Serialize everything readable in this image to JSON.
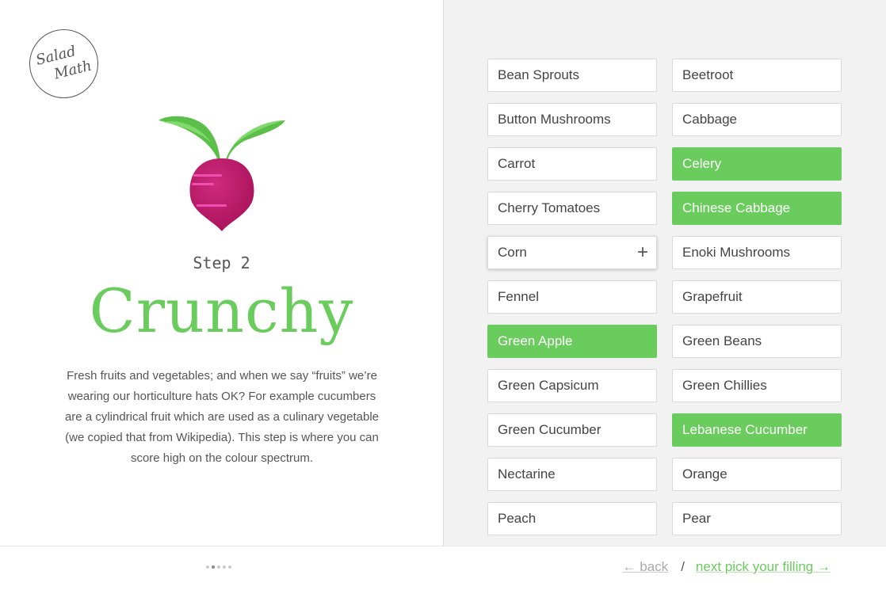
{
  "logo": {
    "line1": "Salad",
    "line2": "Math"
  },
  "step": {
    "label": "Step 2",
    "title": "Crunchy",
    "description": "Fresh fruits and vegetables; and when we say “fruits” we’re wearing our horticulture hats OK? For example cucumbers are a cylindrical fruit which are used as a culinary vegetable (we copied that from Wikipedia). This step is where you can score high on the colour spectrum."
  },
  "ingredients": [
    {
      "label": "Bean Sprouts",
      "selected": false
    },
    {
      "label": "Beetroot",
      "selected": false
    },
    {
      "label": "Button Mushrooms",
      "selected": false
    },
    {
      "label": "Cabbage",
      "selected": false
    },
    {
      "label": "Carrot",
      "selected": false
    },
    {
      "label": "Celery",
      "selected": true
    },
    {
      "label": "Cherry Tomatoes",
      "selected": false
    },
    {
      "label": "Chinese Cabbage",
      "selected": true
    },
    {
      "label": "Corn",
      "selected": false,
      "hover": true,
      "action_icon": "+"
    },
    {
      "label": "Enoki Mushrooms",
      "selected": false
    },
    {
      "label": "Fennel",
      "selected": false
    },
    {
      "label": "Grapefruit",
      "selected": false
    },
    {
      "label": "Green Apple",
      "selected": true
    },
    {
      "label": "Green Beans",
      "selected": false
    },
    {
      "label": "Green Capsicum",
      "selected": false
    },
    {
      "label": "Green Chillies",
      "selected": false
    },
    {
      "label": "Green Cucumber",
      "selected": false
    },
    {
      "label": "Lebanese Cucumber",
      "selected": true
    },
    {
      "label": "Nectarine",
      "selected": false
    },
    {
      "label": "Orange",
      "selected": false
    },
    {
      "label": "Peach",
      "selected": false
    },
    {
      "label": "Pear",
      "selected": false
    }
  ],
  "footer": {
    "progress": {
      "total": 5,
      "current": 2
    },
    "back_label": "← back",
    "separator": "/",
    "next_label": "next pick your filling →"
  },
  "colors": {
    "accent": "#6acc5c",
    "beet": "#c41f6e",
    "leaf": "#5cbf4a"
  },
  "icons": {
    "hero": "beetroot-illustration",
    "logo": "salad-math-logo",
    "add": "plus-icon"
  }
}
